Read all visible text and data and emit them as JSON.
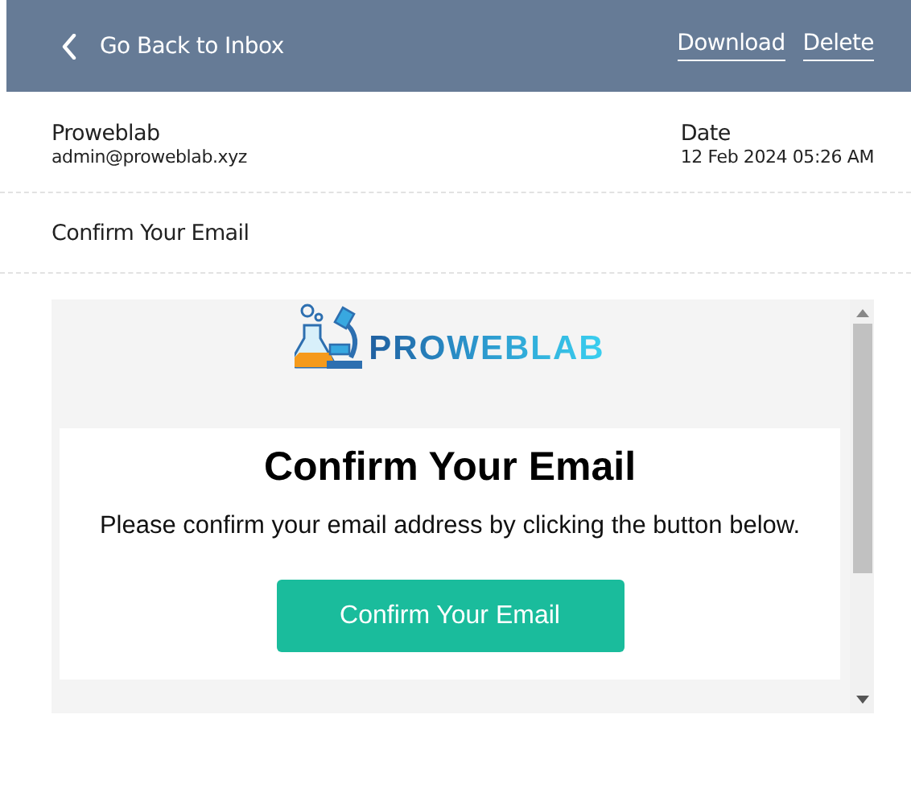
{
  "toolbar": {
    "back_label": "Go Back to Inbox",
    "actions": [
      "Download",
      "Delete"
    ]
  },
  "sender": {
    "name": "Proweblab",
    "email": "admin@proweblab.xyz"
  },
  "date": {
    "label": "Date",
    "value": "12 Feb 2024 05:26 AM"
  },
  "subject": "Confirm Your Email",
  "email_body": {
    "logo_text": "PROWEBLAB",
    "heading": "Confirm Your Email",
    "message": "Please confirm your email address by clicking the button below.",
    "button": "Confirm Your Email"
  }
}
